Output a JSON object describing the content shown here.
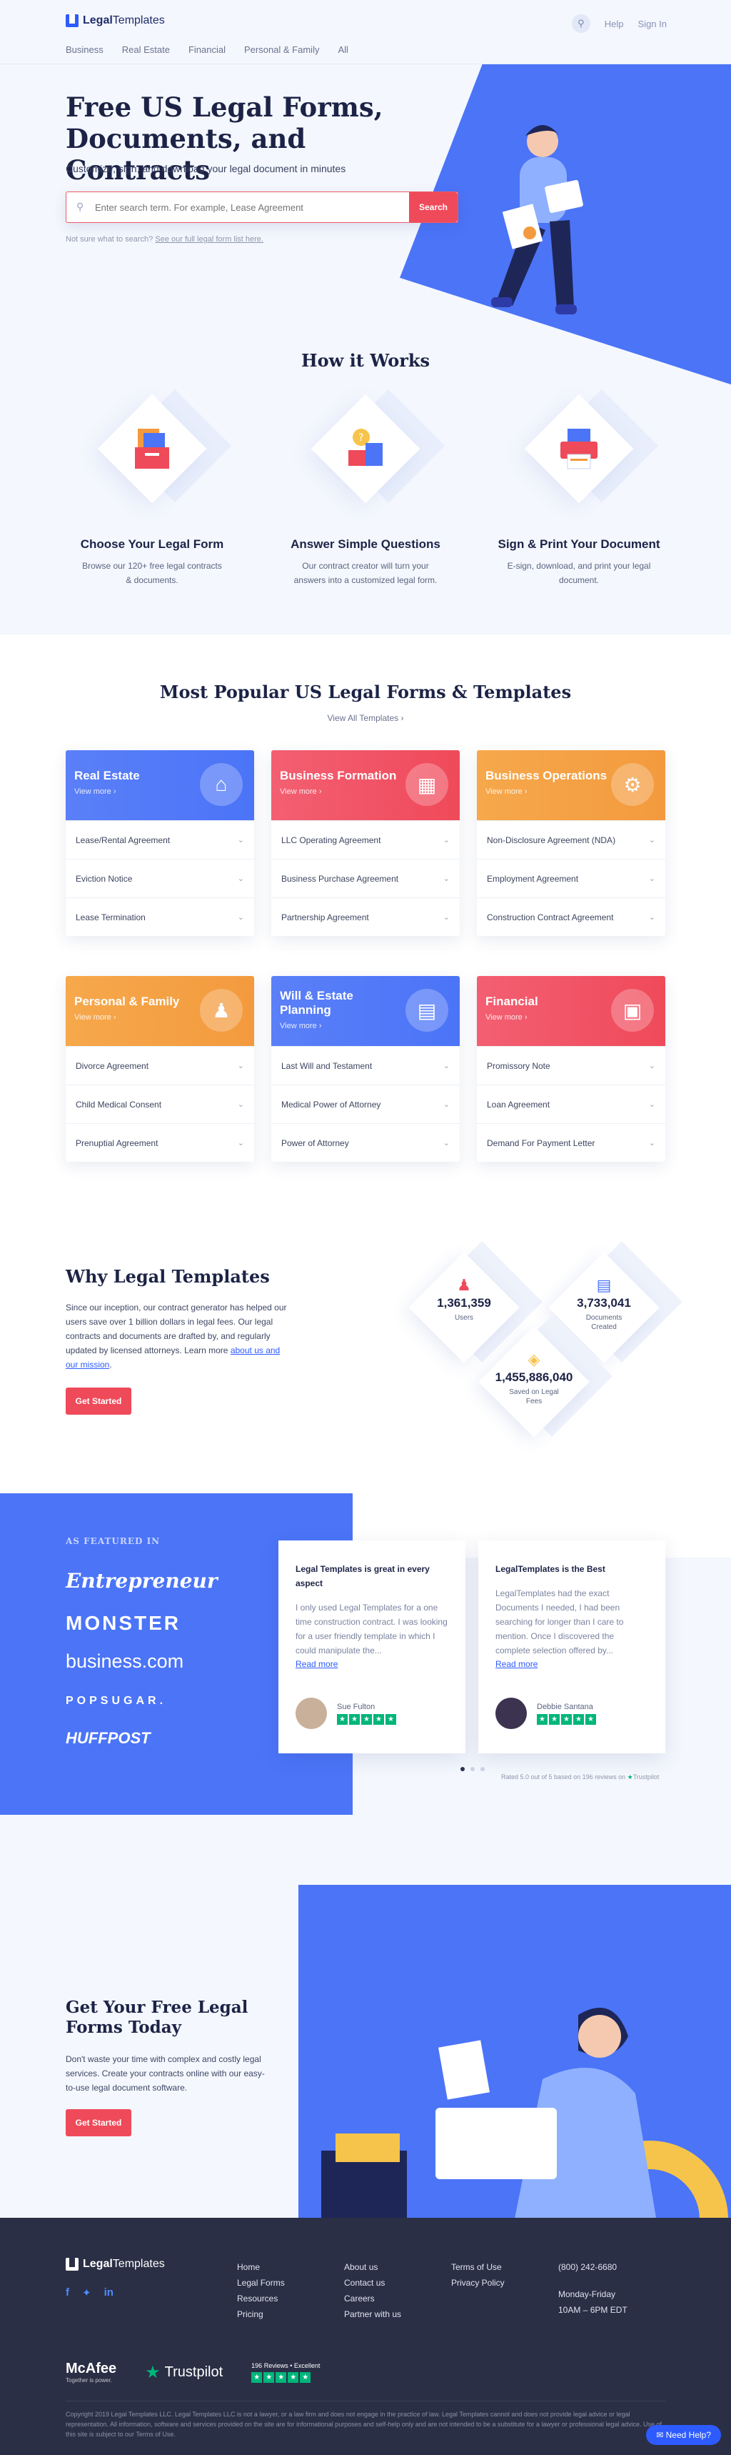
{
  "header": {
    "logo_bold": "Legal",
    "logo_rest": "Templates",
    "nav": [
      "Business",
      "Real Estate",
      "Financial",
      "Personal & Family",
      "All"
    ],
    "help": "Help",
    "sign_in": "Sign In"
  },
  "hero": {
    "title": "Free US Legal Forms, Documents, and Contracts",
    "subtitle": "Customize, sign, and download your legal document in minutes",
    "search_placeholder": "Enter search term. For example, Lease Agreement",
    "search_button": "Search",
    "hint_prefix": "Not sure what to search?",
    "hint_link": "See our full legal form list here."
  },
  "how": {
    "title": "How it Works",
    "steps": [
      {
        "title": "Choose Your Legal Form",
        "text": "Browse our 120+ free legal contracts & documents."
      },
      {
        "title": "Answer Simple Questions",
        "text": "Our contract creator will turn your answers into a customized legal form."
      },
      {
        "title": "Sign & Print Your Document",
        "text": "E-sign, download, and print your legal document."
      }
    ]
  },
  "popular": {
    "title": "Most Popular US Legal Forms & Templates",
    "view_all": "View All Templates",
    "view_more": "View more",
    "cards": [
      {
        "title": "Real Estate",
        "rows": [
          "Lease/Rental Agreement",
          "Eviction Notice",
          "Lease Termination"
        ]
      },
      {
        "title": "Business Formation",
        "rows": [
          "LLC Operating Agreement",
          "Business Purchase Agreement",
          "Partnership Agreement"
        ]
      },
      {
        "title": "Business Operations",
        "rows": [
          "Non-Disclosure Agreement (NDA)",
          "Employment Agreement",
          "Construction Contract Agreement"
        ]
      },
      {
        "title": "Personal & Family",
        "rows": [
          "Divorce Agreement",
          "Child Medical Consent",
          "Prenuptial Agreement"
        ]
      },
      {
        "title": "Will & Estate Planning",
        "rows": [
          "Last Will and Testament",
          "Medical Power of Attorney",
          "Power of Attorney"
        ]
      },
      {
        "title": "Financial",
        "rows": [
          "Promissory Note",
          "Loan Agreement",
          "Demand For Payment Letter"
        ]
      }
    ]
  },
  "why": {
    "title": "Why Legal Templates",
    "text": "Since our inception, our contract generator has helped our users save over 1 billion dollars in legal fees. Our legal contracts and documents are drafted by, and regularly updated by licensed attorneys. Learn more",
    "link": "about us and our mission",
    "button": "Get Started",
    "stats": [
      {
        "num": "1,361,359",
        "label": "Users"
      },
      {
        "num": "3,733,041",
        "label": "Documents Created"
      },
      {
        "num": "1,455,886,040",
        "label": "Saved on Legal Fees"
      }
    ]
  },
  "featured": {
    "label": "AS FEATURED IN",
    "press": [
      "Entrepreneur",
      "MONSTER",
      "business.com",
      "POPSUGAR.",
      "HUFFPOST"
    ],
    "reviews": [
      {
        "title": "Legal Templates is great in every aspect",
        "text": "I only used Legal Templates for a one time construction contract. I was looking for a user friendly template in which I could manipulate the...",
        "more": "Read more",
        "name": "Sue Fulton"
      },
      {
        "title": "LegalTemplates is the Best",
        "text": "LegalTemplates had the exact Documents I needed, I had been searching for longer than I care to mention. Once I discovered the complete selection offered by...",
        "more": "Read more",
        "name": "Debbie Santana"
      }
    ],
    "rated": "Rated 5.0 out of 5 based on 196 reviews on",
    "trustpilot": "Trustpilot"
  },
  "cta": {
    "title": "Get Your Free Legal Forms Today",
    "text": "Don't waste your time with complex and costly legal services. Create your contracts online with our easy-to-use legal document software.",
    "button": "Get Started"
  },
  "footer": {
    "col1": [
      "Home",
      "Legal Forms",
      "Resources",
      "Pricing"
    ],
    "col2": [
      "About us",
      "Contact us",
      "Careers",
      "Partner with us"
    ],
    "col3": [
      "Terms of Use",
      "Privacy Policy"
    ],
    "phone": "(800) 242-6680",
    "hours_days": "Monday-Friday",
    "hours_time": "10AM – 6PM EDT",
    "mcafee": "McAfee",
    "mcafee_sub": "Together is power.",
    "trustpilot": "Trustpilot",
    "tp_badge": "196 Reviews • Excellent",
    "copyright": "Copyright 2019 Legal Templates LLC. Legal Templates LLC is not a lawyer, or a law firm and does not engage in the practice of law. Legal Templates cannot and does not provide legal advice or legal representation. All information, software and services provided on the site are for informational purposes and self-help only and are not intended to be a substitute for a lawyer or professional legal advice. Use of this site is subject to our Terms of Use.",
    "need_help": "Need Help?"
  },
  "colors": {
    "accent": "#4b74f7",
    "cta": "#ef4a5a",
    "orange": "#f39a3e",
    "dark": "#2a2f45"
  }
}
